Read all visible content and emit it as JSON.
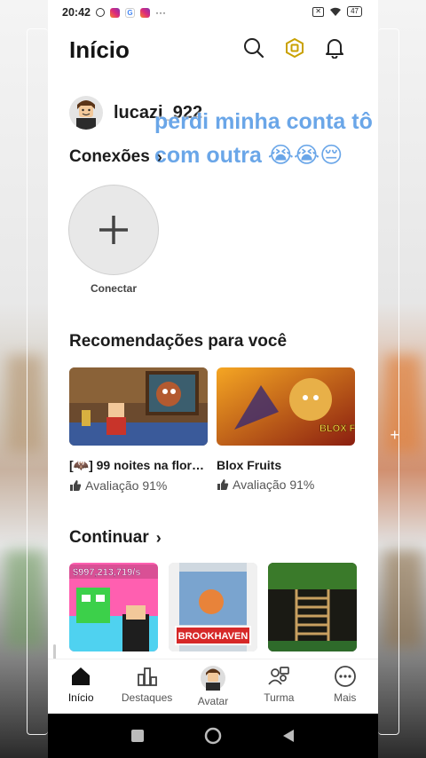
{
  "status_bar": {
    "time": "20:42",
    "dots": "···",
    "google_letter": "G",
    "battery": "47"
  },
  "header": {
    "title": "Início"
  },
  "profile": {
    "username": "lucazi_922"
  },
  "overlay_caption": "perdi minha conta tô com outra 😭😭😔",
  "connections": {
    "title": "Conexões",
    "connect_label": "Conectar"
  },
  "recommendations": {
    "title": "Recomendações para você",
    "games": [
      {
        "name": "[🦇] 99 noites na flor…",
        "rating": "Avaliação 91%"
      },
      {
        "name": "Blox Fruits",
        "rating": "Avaliação 91%"
      }
    ]
  },
  "continue": {
    "title": "Continuar",
    "items": [
      {
        "overlay_text": "$997,213,719/s"
      },
      {
        "overlay_text": "BROOKHAVEN"
      },
      {
        "overlay_text": ""
      }
    ]
  },
  "thumb_text": {
    "blox_fruits": "BLOX FRUITS"
  },
  "bottom_nav": [
    {
      "label": "Início",
      "icon": "home-icon",
      "active": true
    },
    {
      "label": "Destaques",
      "icon": "charts-icon",
      "active": false
    },
    {
      "label": "Avatar",
      "icon": "avatar-icon",
      "active": false
    },
    {
      "label": "Turma",
      "icon": "group-icon",
      "active": false
    },
    {
      "label": "Mais",
      "icon": "more-icon",
      "active": false
    }
  ],
  "colors": {
    "overlay_text": "#6aa6e8",
    "text_primary": "#1c1c1c",
    "system_nav": "#000000"
  }
}
